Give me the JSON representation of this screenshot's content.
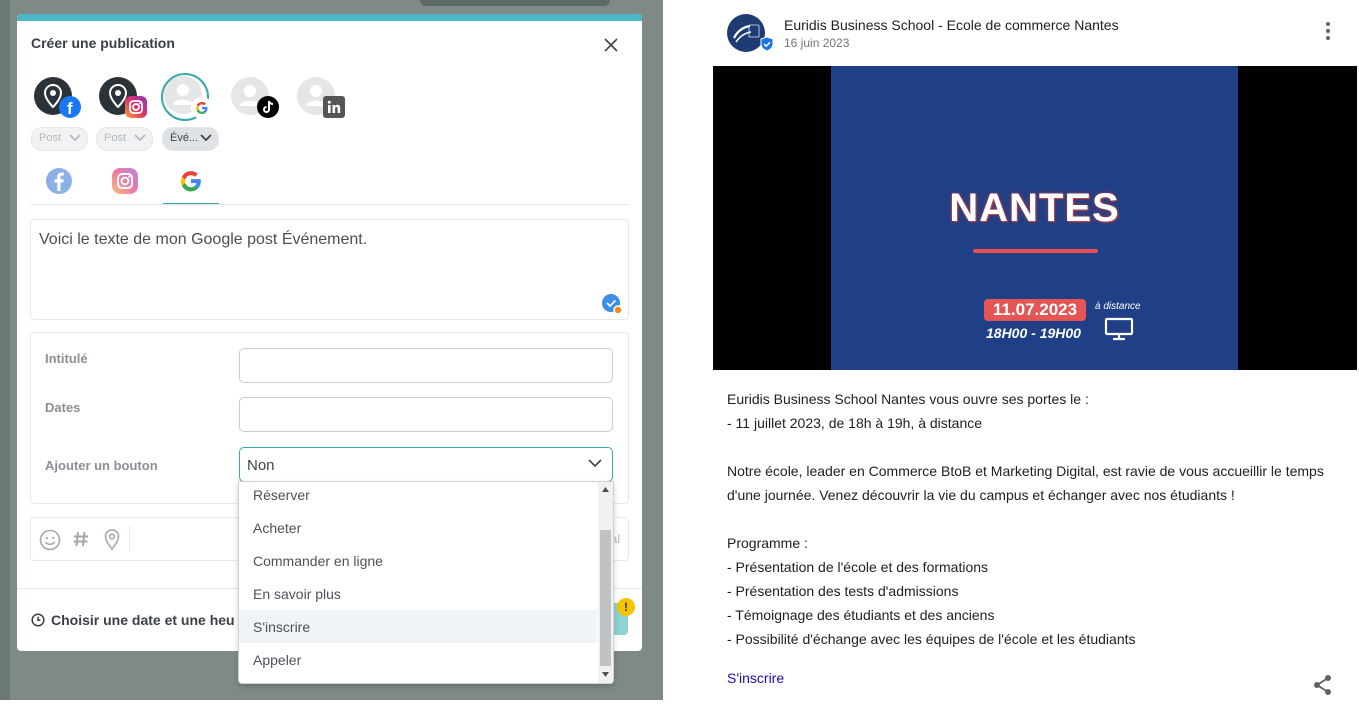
{
  "modal": {
    "title": "Créer une publication",
    "post_types": [
      "Post",
      "Post",
      "Évé..."
    ],
    "editor_text": "Voici le texte de mon Google post Événement.",
    "fields": {
      "title_label": "Intitulé",
      "dates_label": "Dates",
      "button_label": "Ajouter un bouton",
      "button_value": "Non"
    },
    "toolbar_right_text": "al",
    "schedule_label": "Choisir une date et une heu",
    "warning_badge": "!",
    "dropdown_options": [
      "Réserver",
      "Acheter",
      "Commander en ligne",
      "En savoir plus",
      "S'inscrire",
      "Appeler"
    ],
    "highlighted_option": "S'inscrire"
  },
  "preview": {
    "business_name": "Euridis Business School - Ecole de commerce Nantes",
    "date": "16 juin 2023",
    "media": {
      "city": "NANTES",
      "event_date": "11.07.2023",
      "mode": "à distance",
      "hours": "18H00 - 19H00"
    },
    "description": [
      "Euridis Business School Nantes vous ouvre ses portes le :",
      "- 11 juillet 2023, de 18h à 19h, à distance",
      "",
      "Notre école, leader en Commerce BtoB et Marketing Digital, est ravie de vous accueillir le temps",
      "d'une journée. Venez découvrir la vie du campus et échanger avec nos étudiants !",
      "",
      "Programme :",
      "- Présentation de l'école et des formations",
      "- Présentation des tests d'admissions",
      "- Témoignage des étudiants et des anciens",
      "- Possibilité d'échange avec les équipes de l'école et les étudiants"
    ],
    "cta": "S'inscrire"
  },
  "colors": {
    "accent": "#3aa7a8",
    "link": "#1a0dab",
    "media_bg": "#1f3f86",
    "warning": "#f5c400"
  },
  "icons": [
    "close-icon",
    "facebook-icon",
    "instagram-icon",
    "google-icon",
    "tiktok-icon",
    "linkedin-icon",
    "emoji-icon",
    "hashtag-icon",
    "location-icon",
    "clock-icon",
    "chevron-down-icon",
    "verified-icon",
    "more-vert-icon",
    "share-icon",
    "monitor-icon"
  ]
}
